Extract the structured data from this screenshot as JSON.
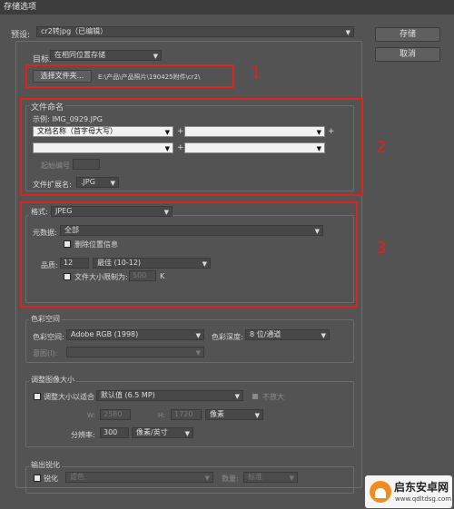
{
  "window": {
    "title": "存储选项"
  },
  "preset": {
    "label": "预设:",
    "value": "cr2转jpg（已编辑）"
  },
  "buttons": {
    "save": "存储",
    "cancel": "取消"
  },
  "target": {
    "label": "目标:",
    "value": "在相同位置存储",
    "choose_folder": "选择文件夹...",
    "path": "E:\\产品\\产品照片\\190425附件\\cr2\\"
  },
  "file_naming": {
    "title": "文件命名",
    "example": "示例: IMG_0929.JPG",
    "field1": "文档名称（首字母大写）",
    "start_number_label": "起始编号",
    "ext_label": "文件扩展名:",
    "ext_value": ".JPG"
  },
  "format": {
    "label": "格式:",
    "value": "JPEG",
    "metadata_label": "元数据:",
    "metadata_value": "全部",
    "remove_location": "删除位置信息",
    "quality_label": "品质:",
    "quality_value": "12",
    "quality_range": "最佳 (10-12)",
    "limit_size": "文件大小限制为:",
    "limit_size_value": "500",
    "limit_unit": "K"
  },
  "color_space": {
    "title": "色彩空间",
    "label": "色彩空间:",
    "value": "Adobe RGB (1998)",
    "depth_label": "色彩深度:",
    "depth_value": "8 位/通道",
    "intent_label": "意图(I):"
  },
  "resize": {
    "title": "调整图像大小",
    "fit_label": "调整大小以适合",
    "fit_value": "默认值 (6.5 MP)",
    "no_enlarge": "不放大",
    "w_label": "W:",
    "w_value": "2580",
    "h_label": "H:",
    "h_value": "1720",
    "unit": "像素",
    "resolution_label": "分辨率:",
    "resolution_value": "300",
    "resolution_unit": "像素/英寸"
  },
  "sharpen": {
    "title": "输出锐化",
    "label": "锐化",
    "value": "滤色",
    "amount_label": "数量:",
    "amount_value": "标准"
  },
  "annotations": {
    "n1": "1",
    "n2": "2",
    "n3": "3"
  },
  "watermark": {
    "brand": "启东安卓网",
    "url": "www.qdltdsg.com"
  },
  "colors": {
    "annotation": "#e0221b",
    "panel": "#535353"
  }
}
